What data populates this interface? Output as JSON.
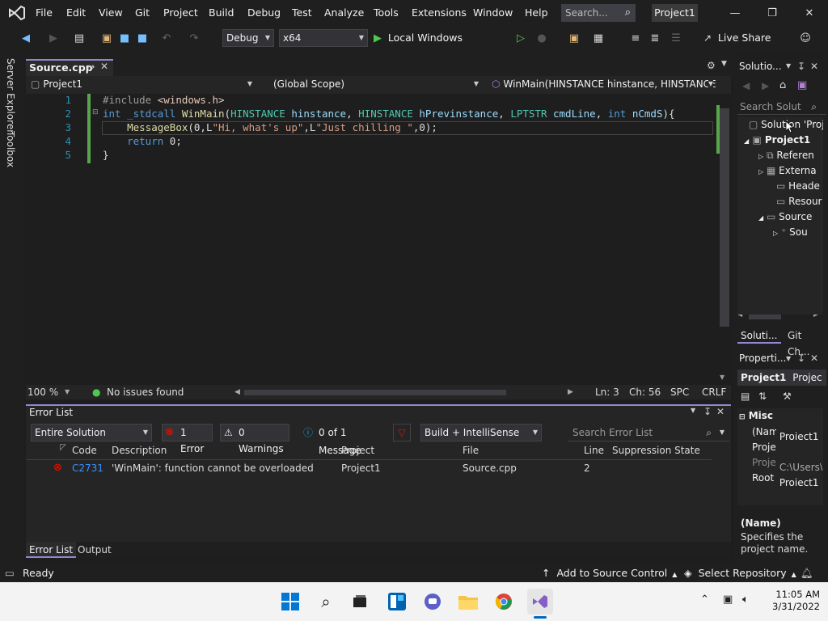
{
  "menu": [
    "File",
    "Edit",
    "View",
    "Git",
    "Project",
    "Build",
    "Debug",
    "Test",
    "Analyze",
    "Tools",
    "Extensions",
    "Window",
    "Help"
  ],
  "search": {
    "placeholder": "Search..."
  },
  "project_badge": "Project1",
  "toolbar": {
    "config": "Debug",
    "platform": "x64",
    "run_label": "Local Windows Debugger",
    "live_share": "Live Share"
  },
  "editor": {
    "tab": "Source.cpp",
    "nav_project": "Project1",
    "nav_scope": "(Global Scope)",
    "nav_member": "WinMain(HINSTANCE hinstance, HINSTANCE h",
    "line_numbers": [
      "1",
      "2",
      "3",
      "4",
      "5"
    ],
    "zoom": "100 %",
    "issues": "No issues found",
    "ln": "Ln: 3",
    "ch": "Ch: 56",
    "spc": "SPC",
    "crlf": "CRLF"
  },
  "side_tabs": {
    "server_explorer": "Server Explorer",
    "toolbox": "Toolbox"
  },
  "error_list": {
    "title": "Error List",
    "scope": "Entire Solution",
    "errors": "1 Error",
    "warnings": "0 Warnings",
    "messages": "0 of 1 Message",
    "source": "Build + IntelliSense",
    "search_placeholder": "Search Error List",
    "columns": {
      "code": "Code",
      "description": "Description",
      "project": "Project",
      "file": "File",
      "line": "Line",
      "suppression": "Suppression State"
    },
    "rows": [
      {
        "code": "C2731",
        "description": "'WinMain': function cannot be overloaded",
        "project": "Project1",
        "file": "Source.cpp",
        "line": "2",
        "suppression": ""
      }
    ],
    "tabs": [
      "Error List",
      "Output"
    ]
  },
  "solution_explorer": {
    "title": "Solutio...",
    "search": "Search Solut",
    "items": [
      "Solution 'Proj",
      "Project1",
      "Referen",
      "Externa",
      "Heade",
      "Resour",
      "Source",
      "Sou"
    ],
    "tabs": [
      "Soluti...",
      "Git Ch..."
    ]
  },
  "properties": {
    "title": "Properti...",
    "object": "Project1",
    "object_type": "Projec",
    "category": "Misc",
    "rows": [
      {
        "k": "(Nam",
        "v": "Project1"
      },
      {
        "k": "Proje",
        "v": ""
      },
      {
        "k": "Proje",
        "v": "C:\\Users\\V"
      },
      {
        "k": "Root",
        "v": "Project1"
      }
    ],
    "desc_title": "(Name)",
    "desc_text": "Specifies the project name."
  },
  "statusbar": {
    "ready": "Ready",
    "source_control": "Add to Source Control",
    "repo": "Select Repository"
  },
  "taskbar": {
    "time": "11:05 AM",
    "date": "3/31/2022"
  }
}
